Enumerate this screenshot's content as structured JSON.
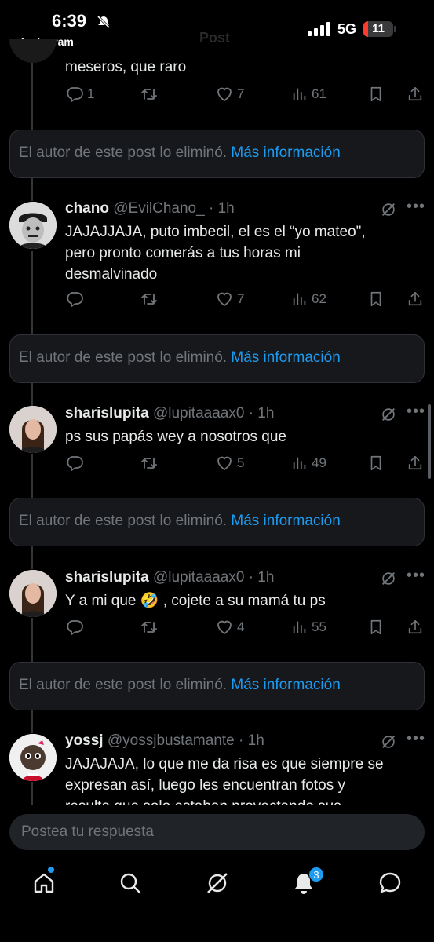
{
  "status_bar": {
    "time": "6:39",
    "back_app": "◂ Instagram",
    "network": "5G",
    "battery": "11"
  },
  "header": {
    "title": "Post"
  },
  "top_fragment": {
    "text": "meseros, que raro",
    "replies": "1",
    "likes": "7",
    "views": "61"
  },
  "deleted_notice": {
    "text": "El autor de este post lo eliminó.",
    "link": "Más información"
  },
  "tweets": [
    {
      "name": "chano",
      "handle": "@EvilChano_",
      "time": "· 1h",
      "text": [
        "JAJAJJAJA, puto imbecil, el es el “yo mateo\",",
        "pero pronto comerás a tus horas mi",
        "desmalvinado"
      ],
      "replies": "",
      "likes": "7",
      "views": "62"
    },
    {
      "name": "sharislupita",
      "handle": "@lupitaaaax0",
      "time": "· 1h",
      "text": [
        "ps sus papás wey a nosotros que"
      ],
      "replies": "",
      "likes": "5",
      "views": "49"
    },
    {
      "name": "sharislupita",
      "handle": "@lupitaaaax0",
      "time": "· 1h",
      "text_parts": [
        "Y a mi que ",
        "🤣",
        " , cojete a su mamá tu ps"
      ],
      "replies": "",
      "likes": "4",
      "views": "55"
    },
    {
      "name": "yossj",
      "handle": "@yossjbustamante",
      "time": "· 1h",
      "text": [
        "JAJAJAJA, lo que me da risa es que siempre se",
        "expresan así, luego les encuentran fotos y",
        "resulta que solo estaban proyectando sus"
      ]
    }
  ],
  "reply_bar": {
    "placeholder": "Postea tu respuesta"
  },
  "bottom_nav": {
    "notifications_badge": "3"
  },
  "icons": [
    "reply-icon",
    "repost-icon",
    "like-icon",
    "views-icon",
    "bookmark-icon",
    "share-icon",
    "grok-icon",
    "more-icon",
    "home-icon",
    "search-icon",
    "grok-nav-icon",
    "notifications-icon",
    "messages-icon"
  ],
  "colors": {
    "background": "#000000",
    "link": "#1d9bf0",
    "muted": "#71767b",
    "text": "#e7e9ea",
    "card": "#16181c"
  }
}
